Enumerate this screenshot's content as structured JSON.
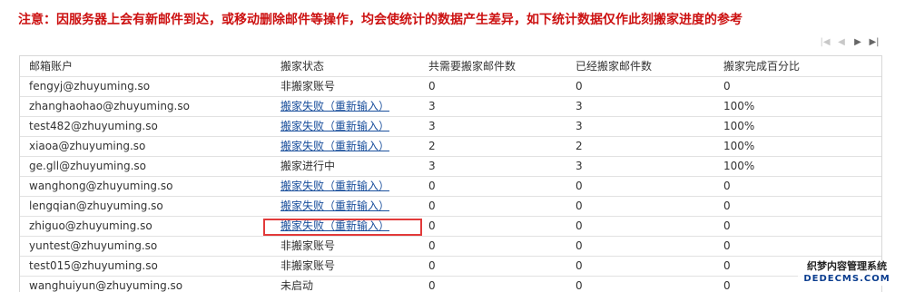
{
  "notice": "注意：因服务器上会有新邮件到达，或移动删除邮件等操作，均会使统计的数据产生差异，如下统计数据仅作此刻搬家进度的参考",
  "pager": {
    "first_icon": "first-page-icon",
    "prev_icon": "prev-page-icon",
    "next_icon": "next-page-icon",
    "last_icon": "last-page-icon"
  },
  "table": {
    "headers": [
      "邮箱账户",
      "搬家状态",
      "共需要搬家邮件数",
      "已经搬家邮件数",
      "搬家完成百分比"
    ],
    "rows": [
      {
        "account": "fengyj@zhuyuming.so",
        "status": "非搬家账号",
        "status_is_link": false,
        "total": "0",
        "done": "0",
        "percent": "0"
      },
      {
        "account": "zhanghaohao@zhuyuming.so",
        "status": "搬家失败（重新输入）",
        "status_is_link": true,
        "total": "3",
        "done": "3",
        "percent": "100%"
      },
      {
        "account": "test482@zhuyuming.so",
        "status": "搬家失败（重新输入）",
        "status_is_link": true,
        "total": "3",
        "done": "3",
        "percent": "100%"
      },
      {
        "account": "xiaoa@zhuyuming.so",
        "status": "搬家失败（重新输入）",
        "status_is_link": true,
        "total": "2",
        "done": "2",
        "percent": "100%"
      },
      {
        "account": "ge.gll@zhuyuming.so",
        "status": "搬家进行中",
        "status_is_link": false,
        "total": "3",
        "done": "3",
        "percent": "100%"
      },
      {
        "account": "wanghong@zhuyuming.so",
        "status": "搬家失败（重新输入）",
        "status_is_link": true,
        "total": "0",
        "done": "0",
        "percent": "0"
      },
      {
        "account": "lengqian@zhuyuming.so",
        "status": "搬家失败（重新输入）",
        "status_is_link": true,
        "total": "0",
        "done": "0",
        "percent": "0"
      },
      {
        "account": "zhiguo@zhuyuming.so",
        "status": "搬家失败（重新输入）",
        "status_is_link": true,
        "total": "0",
        "done": "0",
        "percent": "0"
      },
      {
        "account": "yuntest@zhuyuming.so",
        "status": "非搬家账号",
        "status_is_link": false,
        "total": "0",
        "done": "0",
        "percent": "0"
      },
      {
        "account": "test015@zhuyuming.so",
        "status": "非搬家账号",
        "status_is_link": false,
        "total": "0",
        "done": "0",
        "percent": "0"
      },
      {
        "account": "wanghuiyun@zhuyuming.so",
        "status": "未启动",
        "status_is_link": false,
        "total": "0",
        "done": "0",
        "percent": "0"
      }
    ]
  },
  "watermark": {
    "line1": "织梦内容管理系统",
    "line2": "DEDECMS.COM"
  },
  "colors": {
    "notice": "#cc1111",
    "link": "#1a4f9c",
    "highlight": "#e23a3a"
  }
}
